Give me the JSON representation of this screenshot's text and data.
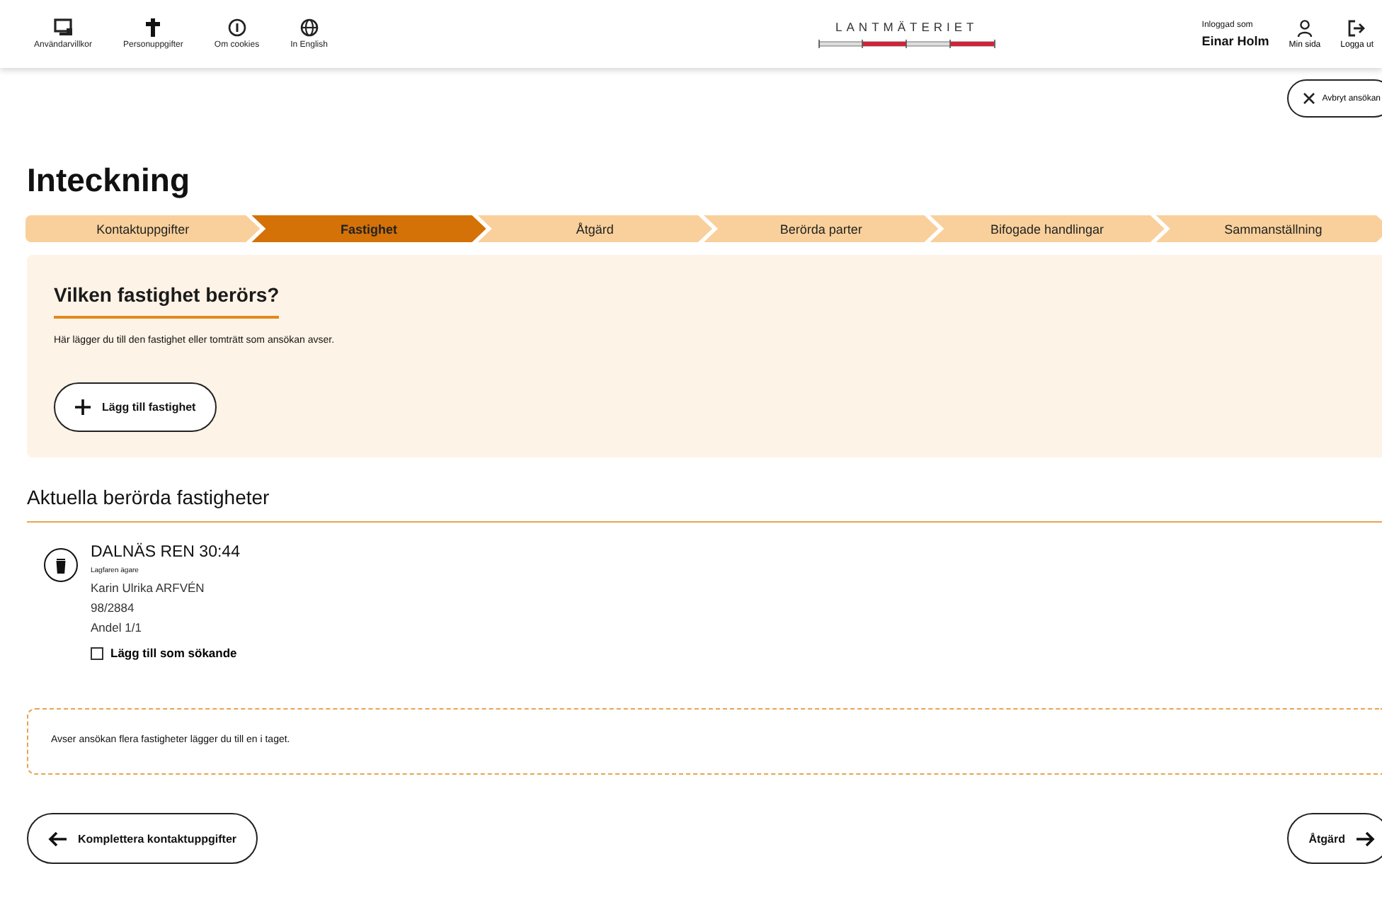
{
  "header": {
    "links": [
      {
        "label": "Användarvillkor"
      },
      {
        "label": "Personuppgifter"
      },
      {
        "label": "Om cookies"
      },
      {
        "label": "In English"
      }
    ],
    "logo": "LANTMÄTERIET",
    "logged_in_label": "Inloggad som",
    "user": "Einar Holm",
    "my_page": "Min sida",
    "logout": "Logga ut"
  },
  "cancel_button": "Avbryt ansökan",
  "title": "Inteckning",
  "steps": [
    {
      "label": "Kontaktuppgifter",
      "selected": false
    },
    {
      "label": "Fastighet",
      "selected": true
    },
    {
      "label": "Åtgärd",
      "selected": false
    },
    {
      "label": "Berörda parter",
      "selected": false
    },
    {
      "label": "Bifogade handlingar",
      "selected": false
    },
    {
      "label": "Sammanställning",
      "selected": false
    }
  ],
  "panel": {
    "heading": "Vilken fastighet berörs?",
    "text": "Här lägger du till den fastighet eller tomträtt som ansökan avser.",
    "add_button": "Lägg till fastighet"
  },
  "section_heading": "Aktuella berörda fastigheter",
  "properties": [
    {
      "name": "DALNÄS REN 30:44",
      "owner_label": "Lagfaren ägare",
      "owner": "Karin Ulrika ARFVÉN",
      "reference": "98/2884",
      "share": "Andel 1/1",
      "checkbox": {
        "label": "Lägg till som sökande",
        "checked": false
      }
    }
  ],
  "info": "Avser ansökan flera fastigheter lägger du till en i taget.",
  "back_button": "Komplettera kontaktuppgifter",
  "next_button": "Åtgärd"
}
